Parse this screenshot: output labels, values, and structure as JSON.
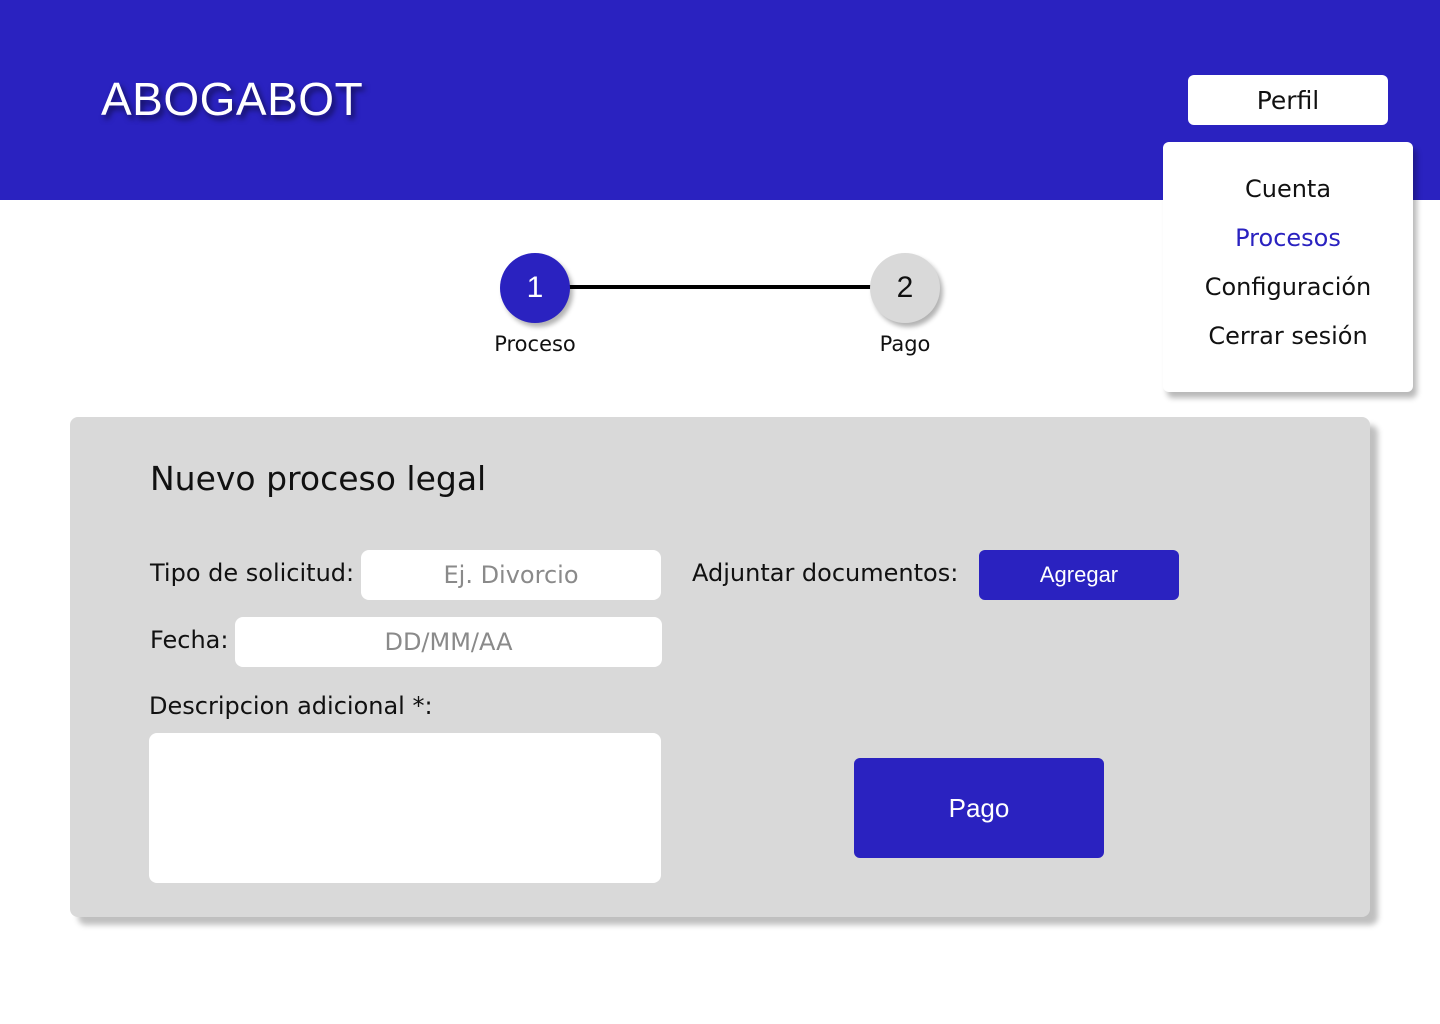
{
  "header": {
    "app_title": "ABOGABOT",
    "profile_button": "Perfil"
  },
  "profile_menu": {
    "items": [
      {
        "label": "Cuenta"
      },
      {
        "label": "Procesos",
        "active": true
      },
      {
        "label": "Configuración"
      },
      {
        "label": "Cerrar sesión"
      }
    ]
  },
  "stepper": {
    "steps": [
      {
        "number": "1",
        "label": "Proceso",
        "state": "current"
      },
      {
        "number": "2",
        "label": "Pago",
        "state": "pending"
      }
    ]
  },
  "form": {
    "title": "Nuevo proceso legal",
    "request_type_label": "Tipo de solicitud:",
    "request_type_placeholder": "Ej. Divorcio",
    "request_type_value": "",
    "date_label": "Fecha:",
    "date_placeholder": "DD/MM/AA",
    "date_value": "",
    "description_label": "Descripcion adicional *:",
    "description_value": "",
    "attach_label": "Adjuntar documentos:",
    "attach_button": "Agregar",
    "submit_button": "Pago"
  },
  "colors": {
    "primary": "#2a22c0",
    "card_background": "#d9d9d9",
    "page_background": "#ffffff"
  }
}
